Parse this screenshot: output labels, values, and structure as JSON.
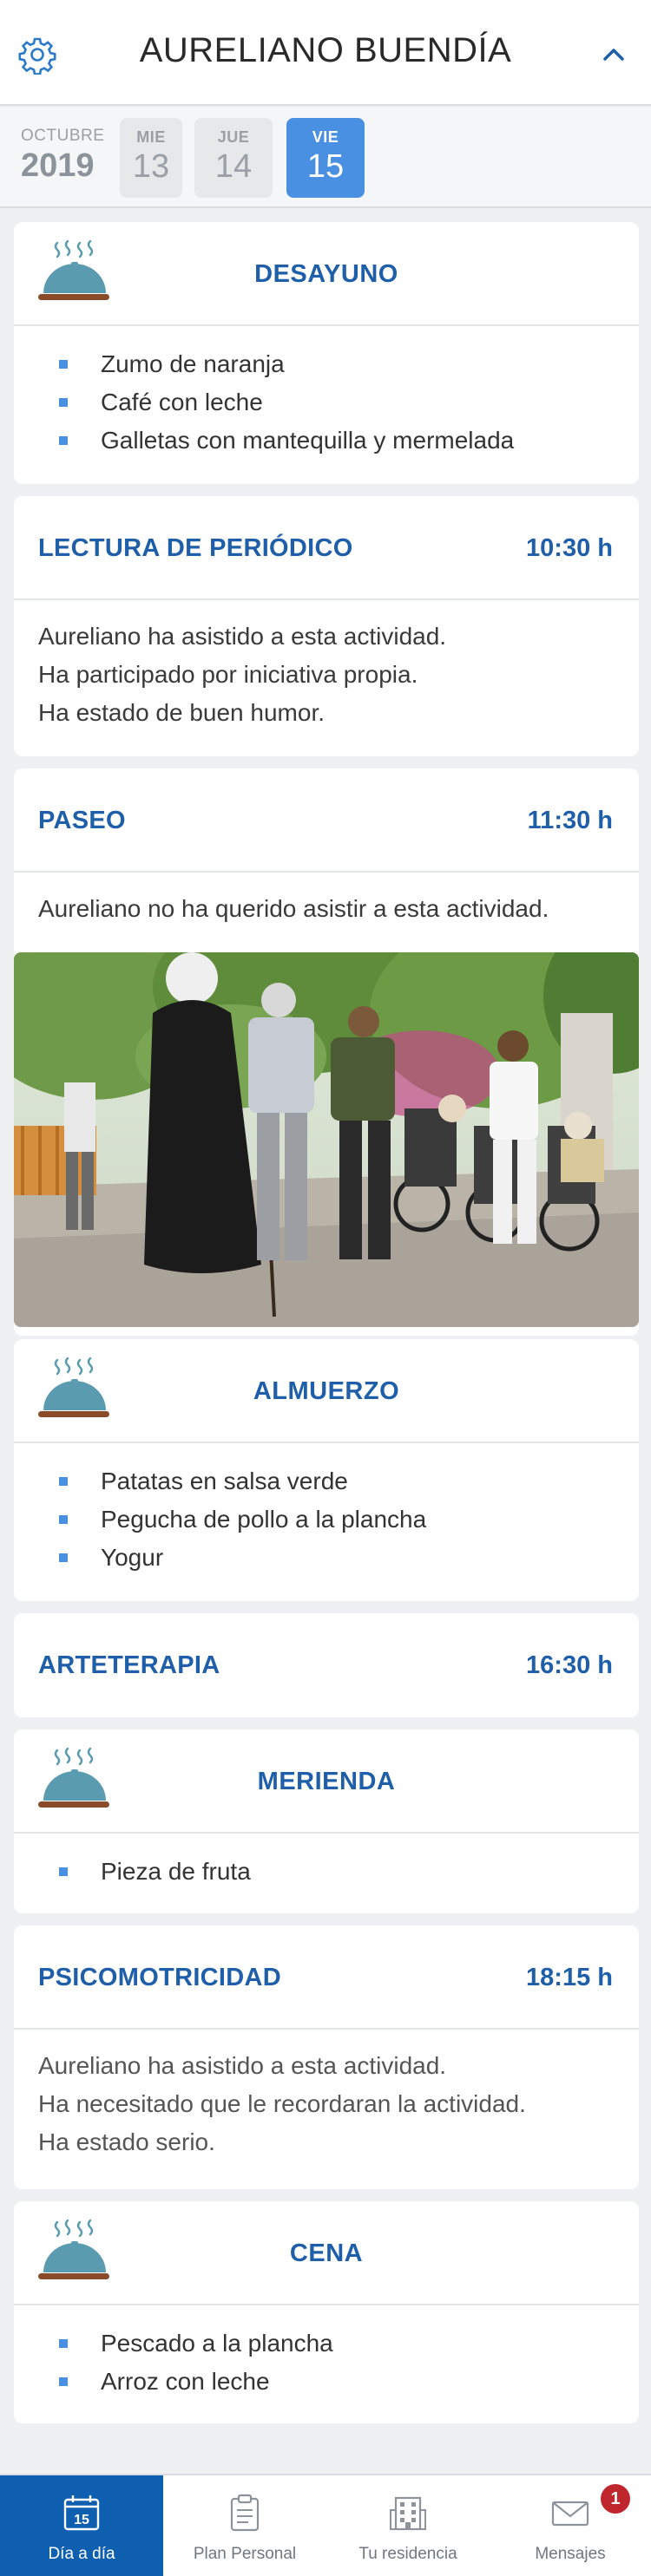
{
  "header": {
    "title": "AURELIANO BUENDÍA",
    "settings_icon": "gear-icon",
    "collapse_icon": "chevron-up-icon"
  },
  "date_strip": {
    "month": "OCTUBRE",
    "year": "2019",
    "days": [
      {
        "name": "MIE",
        "number": "13",
        "selected": false
      },
      {
        "name": "JUE",
        "number": "14",
        "selected": false
      },
      {
        "name": "VIE",
        "number": "15",
        "selected": true
      }
    ]
  },
  "schedule": {
    "desayuno": {
      "title": "DESAYUNO",
      "icon": "food-cloche-icon",
      "items": [
        "Zumo de naranja",
        "Café con leche",
        "Galletas con mantequilla y mermelada"
      ]
    },
    "lectura": {
      "title": "LECTURA DE PERIÓDICO",
      "time": "10:30 h",
      "notes": [
        "Aureliano ha asistido a esta actividad.",
        "Ha participado por iniciativa propia.",
        "Ha estado de buen humor."
      ]
    },
    "paseo": {
      "title": "PASEO",
      "time": "11:30 h",
      "notes": [
        "Aureliano no ha querido asistir a esta actividad."
      ]
    },
    "almuerzo": {
      "title": "ALMUERZO",
      "icon": "food-cloche-icon",
      "items": [
        "Patatas en salsa verde",
        "Pegucha de pollo a la plancha",
        "Yogur"
      ]
    },
    "arteterapia": {
      "title": "ARTETERAPIA",
      "time": "16:30 h"
    },
    "merienda": {
      "title": "MERIENDA",
      "icon": "food-cloche-icon",
      "items": [
        "Pieza de fruta"
      ]
    },
    "psicomotricidad": {
      "title": "PSICOMOTRICIDAD",
      "time": "18:15 h",
      "notes": [
        "Aureliano ha asistido a esta actividad.",
        "Ha necesitado que le recordaran la actividad.",
        "Ha estado serio."
      ]
    },
    "cena": {
      "title": "CENA",
      "icon": "food-cloche-icon",
      "items": [
        "Pescado a la plancha",
        "Arroz con leche"
      ]
    }
  },
  "tabbar": {
    "tabs": [
      {
        "label": "Día a día",
        "icon": "calendar-icon",
        "icon_text": "15",
        "active": true
      },
      {
        "label": "Plan Personal",
        "icon": "clipboard-icon",
        "active": false
      },
      {
        "label": "Tu residencia",
        "icon": "building-icon",
        "active": false
      },
      {
        "label": "Mensajes",
        "icon": "envelope-icon",
        "active": false,
        "badge": "1"
      }
    ]
  },
  "colors": {
    "accent": "#4a90e2",
    "title_blue": "#1f5ea8",
    "tab_active": "#0f5fb0",
    "badge_red": "#c0262d",
    "icon_teal": "#5b9bb0",
    "icon_plate": "#8a4b2a"
  }
}
